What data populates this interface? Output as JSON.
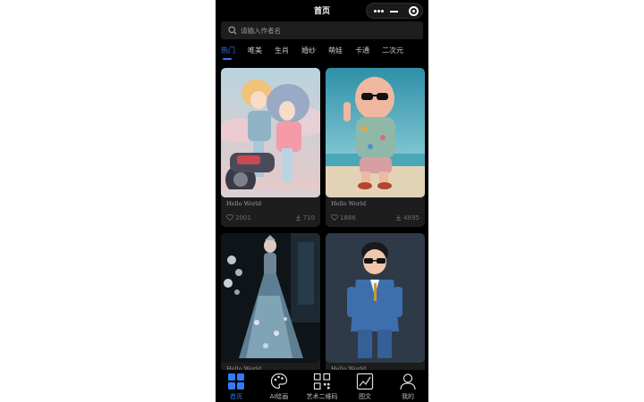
{
  "header": {
    "title": "首页"
  },
  "capsule": {
    "icons": [
      "more-icon",
      "minimize-icon",
      "close-target-icon"
    ]
  },
  "search": {
    "placeholder": "请输入作者名"
  },
  "tabs": [
    {
      "label": "热门",
      "active": true
    },
    {
      "label": "唯美",
      "active": false
    },
    {
      "label": "生肖",
      "active": false
    },
    {
      "label": "婚纱",
      "active": false
    },
    {
      "label": "萌娃",
      "active": false
    },
    {
      "label": "卡通",
      "active": false
    },
    {
      "label": "二次元",
      "active": false
    }
  ],
  "cards": [
    {
      "title": "Hello World",
      "likes": "2001",
      "downloads": "710"
    },
    {
      "title": "Hello World",
      "likes": "1886",
      "downloads": "4895"
    },
    {
      "title": "Hello World",
      "likes": "",
      "downloads": ""
    },
    {
      "title": "Hello World",
      "likes": "",
      "downloads": ""
    }
  ],
  "nav": [
    {
      "label": "首页",
      "icon": "grid-icon",
      "active": true
    },
    {
      "label": "AI绘画",
      "icon": "palette-icon",
      "active": false
    },
    {
      "label": "艺术二维码",
      "icon": "qrcode-icon",
      "active": false
    },
    {
      "label": "图文",
      "icon": "image-edit-icon",
      "active": false
    },
    {
      "label": "我的",
      "icon": "user-icon",
      "active": false
    }
  ],
  "colors": {
    "accent": "#2f7cf6",
    "background": "#000000",
    "card": "#1d1d1d"
  }
}
